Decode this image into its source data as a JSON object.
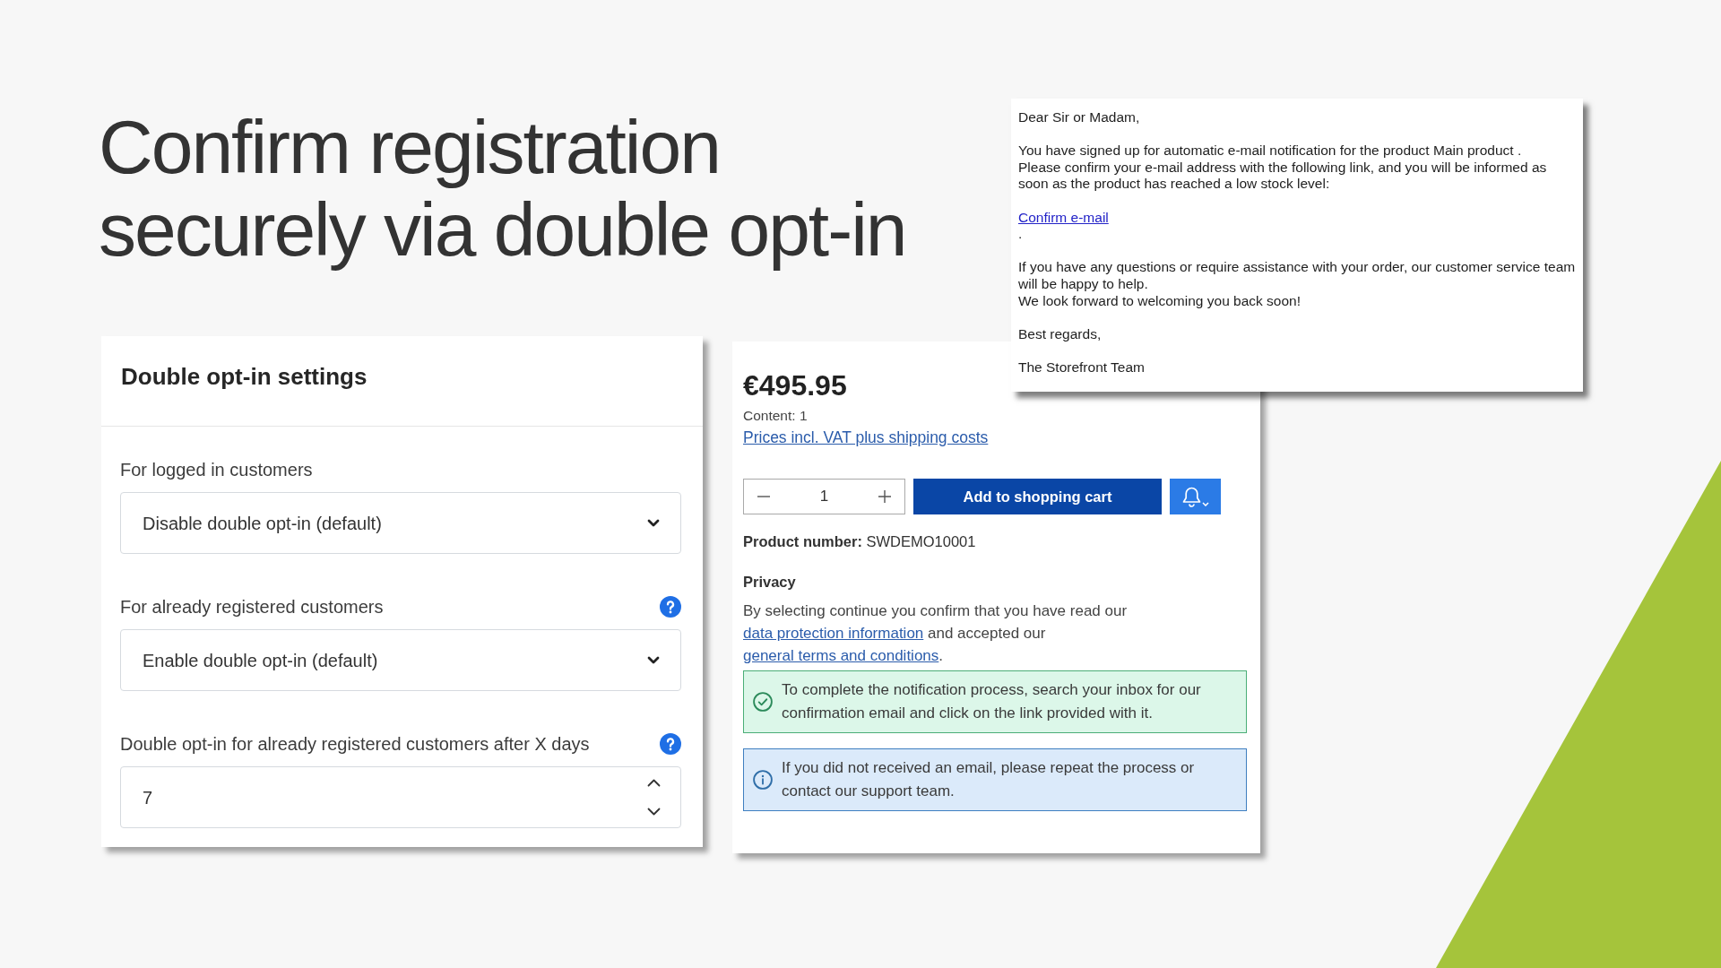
{
  "slide": {
    "title": "Confirm registration securely via double opt-in"
  },
  "settings_panel": {
    "title": "Double opt-in settings",
    "fields": [
      {
        "kind": "select",
        "label": "For logged in customers",
        "value": "Disable double opt-in (default)",
        "help": false
      },
      {
        "kind": "select",
        "label": "For already registered customers",
        "value": "Enable double opt-in (default)",
        "help": true
      },
      {
        "kind": "number",
        "label": "Double opt-in for already registered customers after X days",
        "value": "7",
        "help": true
      }
    ]
  },
  "product": {
    "price": "€495.95",
    "content": "Content: 1",
    "price_note": "Prices incl. VAT plus shipping costs",
    "quantity": "1",
    "add_to_cart": "Add to shopping cart",
    "product_number": "**Product number:** SWDEMO10001",
    "privacy_title": "Privacy",
    "privacy_text": {
      "lines": [
        [
          {
            "kind": "text",
            "text": "By selecting continue you confirm that you have read our"
          }
        ],
        [
          {
            "kind": "link",
            "text": "data protection information"
          },
          {
            "kind": "text",
            "text": " and accepted our"
          }
        ],
        [
          {
            "kind": "link",
            "text": "general terms and conditions"
          },
          {
            "kind": "text",
            "text": "."
          }
        ]
      ]
    },
    "alerts": [
      {
        "kind": "success",
        "text": "To complete the notification process, search your inbox for our confirmation email and click on the link provided with it."
      },
      {
        "kind": "info",
        "text": "If you did not received an email, please repeat the process or contact our support team."
      }
    ]
  },
  "email": {
    "blocks": [
      {
        "lines": [
          {
            "kind": "text",
            "text": "Dear Sir or Madam,"
          }
        ]
      },
      {
        "lines": [
          {
            "kind": "text",
            "text": "You have signed up for automatic e-mail notification for the product Main product ."
          },
          {
            "kind": "text",
            "text": "Please confirm your e-mail address with the following link, and you will be informed as"
          },
          {
            "kind": "text",
            "text": "soon as the product has reached a low stock level:"
          }
        ]
      },
      {
        "lines": [
          {
            "kind": "link",
            "text": "Confirm e-mail"
          },
          {
            "kind": "text",
            "text": "."
          }
        ]
      },
      {
        "lines": [
          {
            "kind": "text",
            "text": "If you have any questions or require assistance with your order, our customer service team"
          },
          {
            "kind": "text",
            "text": "will be happy to help."
          },
          {
            "kind": "text",
            "text": "We look forward to welcoming you back soon!"
          }
        ]
      },
      {
        "lines": [
          {
            "kind": "text",
            "text": "Best regards,"
          }
        ]
      },
      {
        "lines": [
          {
            "kind": "text",
            "text": "The Storefront Team"
          }
        ]
      }
    ]
  }
}
